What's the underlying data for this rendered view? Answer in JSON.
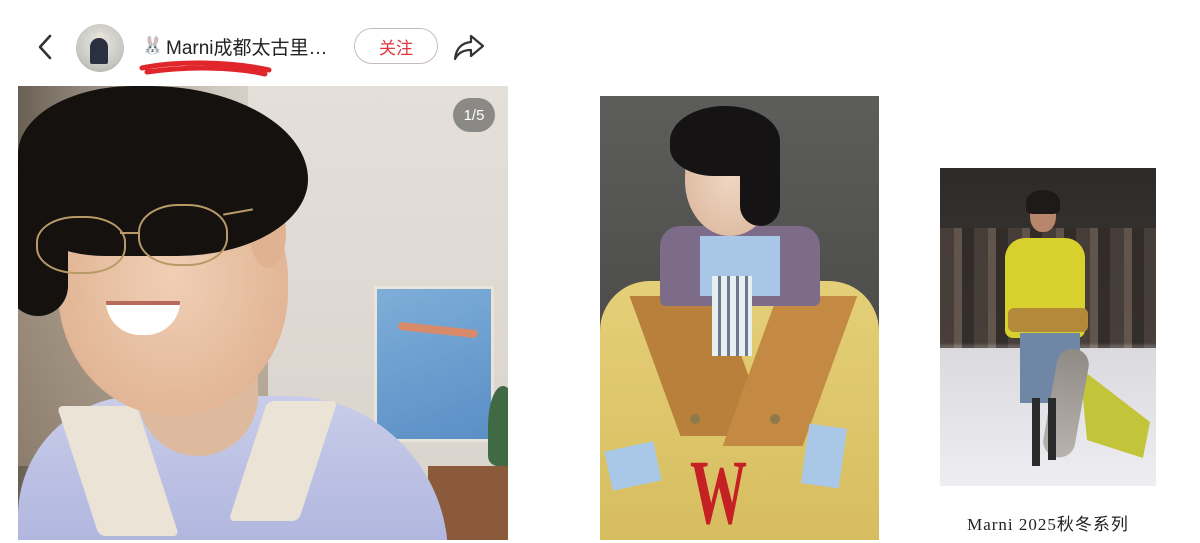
{
  "header": {
    "back_icon": "back-chevron-icon",
    "avatar_icon": "avatar",
    "name_prefix_emoji": "🐰",
    "account_name": "Marni成都太古里…",
    "follow_label": "关注",
    "share_icon": "share-arrow-icon",
    "underline_color": "#e0262b"
  },
  "post": {
    "image_counter": "1/5"
  },
  "images": {
    "middle_magazine_logo": "W",
    "right_caption": "Marni 2025秋冬系列"
  },
  "colors": {
    "follow_text": "#e0373c",
    "magazine_logo": "#c52024"
  }
}
